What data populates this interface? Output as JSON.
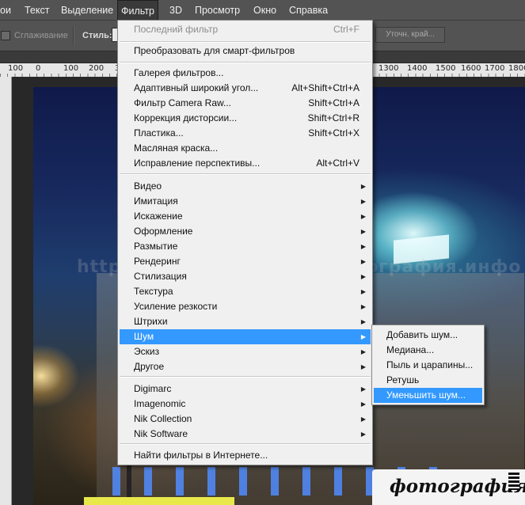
{
  "menubar": {
    "items": [
      "ои",
      "Текст",
      "Выделение",
      "Фильтр",
      "3D",
      "Просмотр",
      "Окно",
      "Справка"
    ],
    "active_index": 3
  },
  "options": {
    "smoothing_label": "Сглаживание",
    "style_label": "Стиль:",
    "refine_edge_label": "Уточн. край..."
  },
  "ruler": {
    "left_labels": [
      "100",
      "0",
      "100",
      "200",
      "3"
    ],
    "right_labels": [
      "1300",
      "1400",
      "1500",
      "1600",
      "1700",
      "1800"
    ]
  },
  "watermark": "http://fotografiya.info/  фотография.инфо",
  "logo_text": "фотография",
  "filter_menu": {
    "last_filter": {
      "label": "Последний фильтр",
      "shortcut": "Ctrl+F"
    },
    "convert_smart": "Преобразовать для смарт-фильтров",
    "group1": [
      {
        "label": "Галерея фильтров...",
        "shortcut": ""
      },
      {
        "label": "Адаптивный широкий угол...",
        "shortcut": "Alt+Shift+Ctrl+A"
      },
      {
        "label": "Фильтр Camera Raw...",
        "shortcut": "Shift+Ctrl+A"
      },
      {
        "label": "Коррекция дисторсии...",
        "shortcut": "Shift+Ctrl+R"
      },
      {
        "label": "Пластика...",
        "shortcut": "Shift+Ctrl+X"
      },
      {
        "label": "Масляная краска...",
        "shortcut": ""
      },
      {
        "label": "Исправление перспективы...",
        "shortcut": "Alt+Ctrl+V"
      }
    ],
    "group2": [
      "Видео",
      "Имитация",
      "Искажение",
      "Оформление",
      "Размытие",
      "Рендеринг",
      "Стилизация",
      "Текстура",
      "Усиление резкости",
      "Штрихи",
      "Шум",
      "Эскиз",
      "Другое"
    ],
    "group2_highlight_index": 10,
    "group3": [
      "Digimarc",
      "Imagenomic",
      "Nik Collection",
      "Nik Software"
    ],
    "browse_online": "Найти фильтры в Интернете..."
  },
  "noise_submenu": {
    "items": [
      "Добавить шум...",
      "Медиана...",
      "Пыль и царапины...",
      "Ретушь",
      "Уменьшить шум..."
    ],
    "highlight_index": 4
  },
  "colors": {
    "highlight": "#3399ff",
    "menu_bg": "#f0f0f0",
    "chrome": "#535353"
  }
}
